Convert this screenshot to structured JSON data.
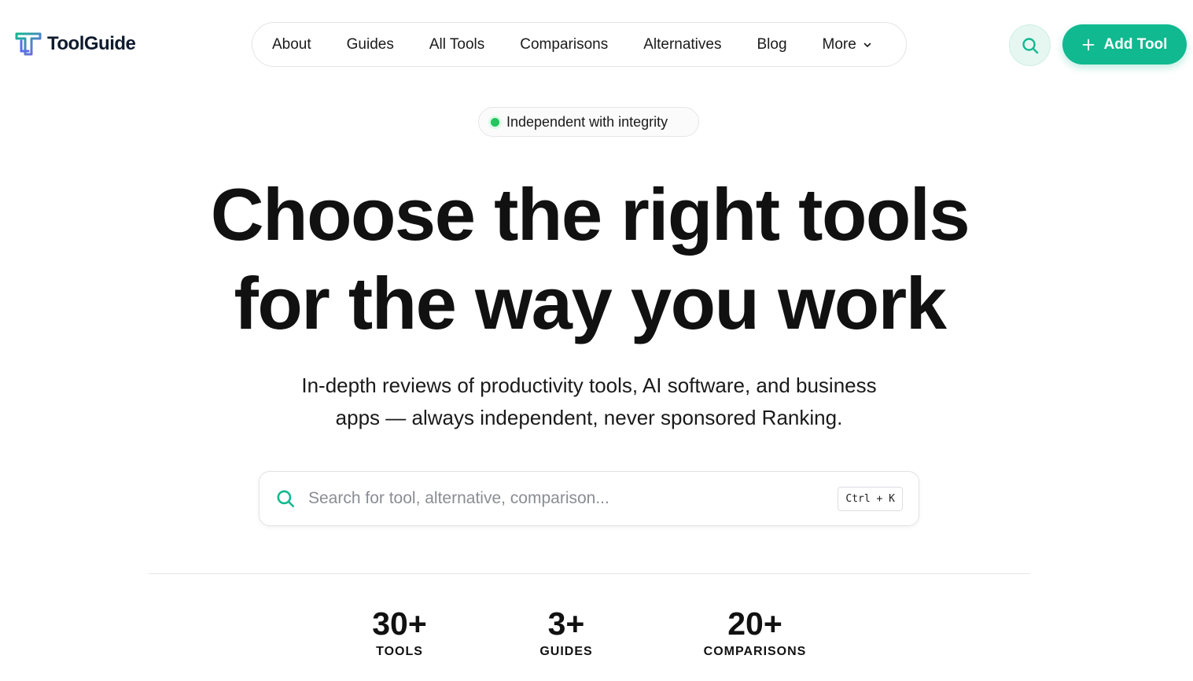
{
  "brand": {
    "name": "ToolGuide",
    "accent": "#10b98f",
    "logo_icon": "tg-logo-icon"
  },
  "nav": {
    "items": [
      {
        "label": "About"
      },
      {
        "label": "Guides"
      },
      {
        "label": "All Tools"
      },
      {
        "label": "Comparisons"
      },
      {
        "label": "Alternatives"
      },
      {
        "label": "Blog"
      }
    ],
    "more_label": "More"
  },
  "header": {
    "add_tool_label": "Add Tool"
  },
  "badge": {
    "text": "Independent with integrity"
  },
  "hero": {
    "title_line1": "Choose the right tools",
    "title_line2": "for the way you work",
    "subtitle_line1": "In-depth reviews of productivity tools, AI software, and business",
    "subtitle_line2": "apps — always independent, never sponsored Ranking."
  },
  "search": {
    "placeholder": "Search for tool, alternative, comparison...",
    "value": "",
    "shortcut": "Ctrl + K"
  },
  "stats": [
    {
      "value": "30+",
      "label": "TOOLS"
    },
    {
      "value": "3+",
      "label": "GUIDES"
    },
    {
      "value": "20+",
      "label": "COMPARISONS"
    }
  ]
}
